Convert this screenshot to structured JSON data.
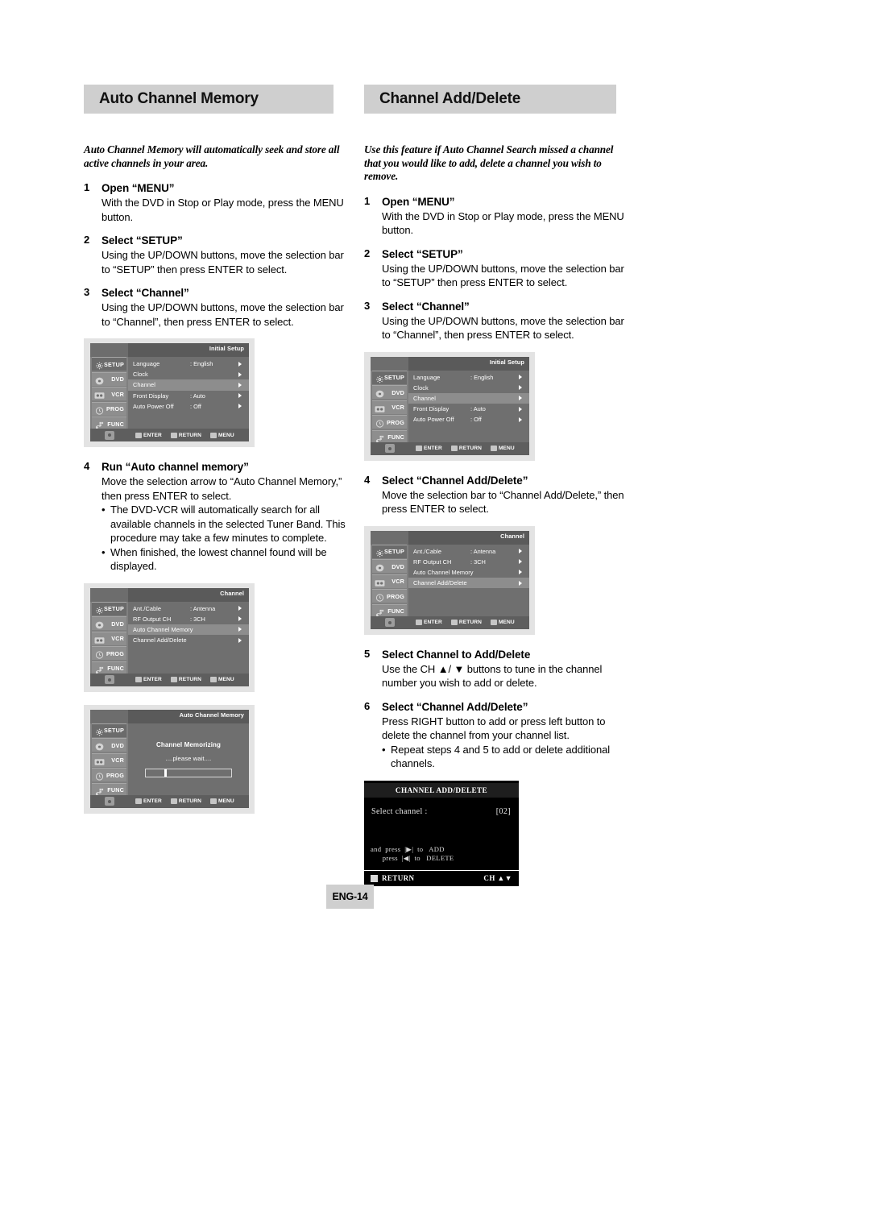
{
  "page": {
    "number_label": "ENG-14"
  },
  "sections": {
    "left": {
      "header": "Auto Channel Memory",
      "intro": "Auto Channel Memory will automatically seek and store all active channels in your area.",
      "steps": [
        {
          "num": "1",
          "title": "Open “MENU”",
          "body": "With the DVD in Stop or Play mode, press the MENU button."
        },
        {
          "num": "2",
          "title": "Select “SETUP”",
          "body": "Using the UP/DOWN  buttons, move the selection bar to “SETUP” then press ENTER to select."
        },
        {
          "num": "3",
          "title": "Select “Channel”",
          "body": "Using the UP/DOWN buttons, move the selection bar to “Channel”, then press ENTER to select."
        },
        {
          "num": "4",
          "title": "Run “Auto channel memory”",
          "body": "Move the selection arrow to “Auto Channel Memory,” then press ENTER to select.",
          "bullets": [
            "The DVD-VCR will automatically search for all available channels in the selected Tuner Band. This procedure may take a few minutes to complete.",
            "When finished, the lowest channel found will be displayed."
          ]
        }
      ]
    },
    "right": {
      "header": "Channel Add/Delete",
      "intro": "Use this feature if Auto Channel Search missed a channel that you would like to add, delete a channel you wish to remove.",
      "steps": [
        {
          "num": "1",
          "title": "Open “MENU”",
          "body": "With the DVD in Stop or Play mode, press the MENU button."
        },
        {
          "num": "2",
          "title": "Select “SETUP”",
          "body": "Using the UP/DOWN  buttons, move the selection bar to “SETUP” then press ENTER to select."
        },
        {
          "num": "3",
          "title": "Select “Channel”",
          "body": "Using the UP/DOWN buttons, move the selection bar to “Channel”, then press ENTER to select."
        },
        {
          "num": "4",
          "title": "Select “Channel Add/Delete”",
          "body": "Move the selection bar to “Channel Add/Delete,” then press ENTER to select."
        },
        {
          "num": "5",
          "title": "Select Channel to Add/Delete",
          "body": "Use the CH ▲/ ▼ buttons to tune in the channel number you wish to add or delete."
        },
        {
          "num": "6",
          "title": "Select “Channel Add/Delete”",
          "body": "Press RIGHT button to add or press left button to delete the channel from your channel list.",
          "bullets": [
            "Repeat steps 4 and 5 to add or delete additional channels."
          ]
        }
      ]
    }
  },
  "osd_common": {
    "rail": [
      {
        "label": "SETUP",
        "icon": "gear-icon"
      },
      {
        "label": "DVD",
        "icon": "disc-icon"
      },
      {
        "label": "VCR",
        "icon": "cassette-icon"
      },
      {
        "label": "PROG",
        "icon": "clock-icon"
      },
      {
        "label": "FUNC",
        "icon": "function-icon"
      }
    ],
    "footer_keys": [
      {
        "label": "ENTER",
        "icon": "enter-key-icon"
      },
      {
        "label": "RETURN",
        "icon": "return-key-icon"
      },
      {
        "label": "MENU",
        "icon": "menu-key-icon"
      }
    ],
    "nav_pad_icon": "dpad-icon"
  },
  "osd_screens": {
    "initial_setup": {
      "title": "Initial Setup",
      "rows": [
        {
          "label": "Language",
          "value": ": English",
          "selected": false
        },
        {
          "label": "Clock",
          "value": "",
          "selected": false
        },
        {
          "label": "Channel",
          "value": "",
          "selected": true
        },
        {
          "label": "Front Display",
          "value": ": Auto",
          "selected": false
        },
        {
          "label": "Auto Power Off",
          "value": ": Off",
          "selected": false
        }
      ]
    },
    "channel_auto_selected": {
      "title": "Channel",
      "rows": [
        {
          "label": "Ant./Cable",
          "value": ": Antenna",
          "selected": false
        },
        {
          "label": "RF Output CH",
          "value": ": 3CH",
          "selected": false
        },
        {
          "label": "Auto Channel Memory",
          "value": "",
          "selected": true
        },
        {
          "label": "Channel Add/Delete",
          "value": "",
          "selected": false
        }
      ]
    },
    "channel_adddelete_selected": {
      "title": "Channel",
      "rows": [
        {
          "label": "Ant./Cable",
          "value": ": Antenna",
          "selected": false
        },
        {
          "label": "RF Output CH",
          "value": ": 3CH",
          "selected": false
        },
        {
          "label": "Auto Channel Memory",
          "value": "",
          "selected": false
        },
        {
          "label": "Channel Add/Delete",
          "value": "",
          "selected": true
        }
      ]
    },
    "auto_channel_memory_progress": {
      "title": "Auto Channel Memory",
      "message": "Channel Memorizing",
      "wait_text": "....please wait....",
      "progress_percent": 22
    },
    "channel_add_delete_dialog": {
      "title": "CHANNEL ADD/DELETE",
      "select_label": "Select channel :",
      "channel_value": "[02]",
      "instructions": "and  press  |▶|  to   ADD\n      press  |◀|  to   DELETE",
      "return_label": "RETURN",
      "ch_label": "CH ▲▼"
    }
  }
}
